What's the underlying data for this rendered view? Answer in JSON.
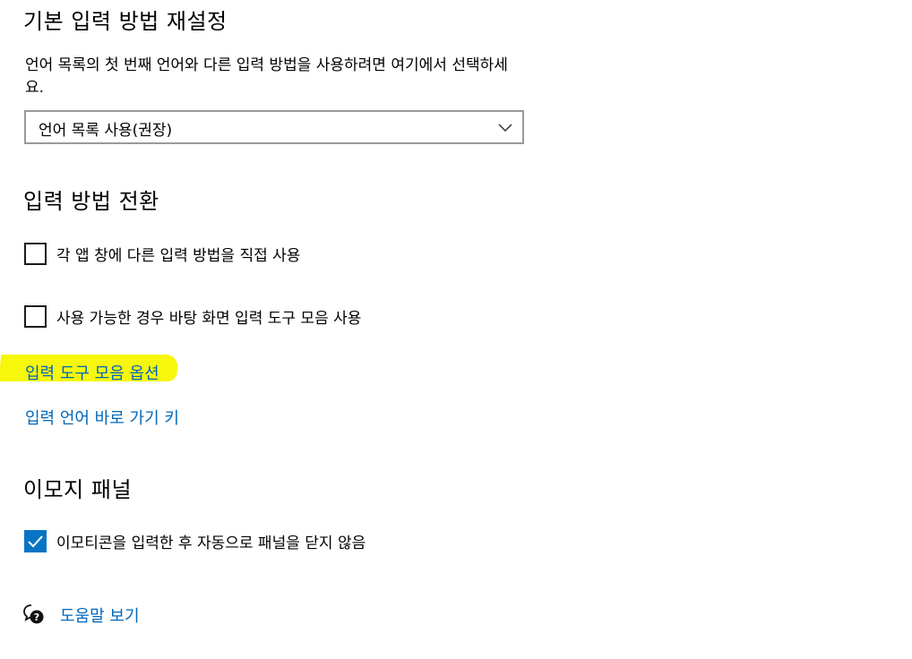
{
  "default_input": {
    "title": "기본 입력 방법 재설정",
    "description": "언어 목록의 첫 번째 언어와 다른 입력 방법을 사용하려면 여기에서 선택하세요.",
    "dropdown_value": "언어 목록 사용(권장)"
  },
  "switching": {
    "title": "입력 방법 전환",
    "option1": {
      "label": "각 앱 창에 다른 입력 방법을 직접 사용",
      "checked": false
    },
    "option2": {
      "label": "사용 가능한 경우 바탕 화면 입력 도구 모음 사용",
      "checked": false
    },
    "link_toolbar_options": "입력 도구 모음 옵션",
    "link_hotkeys": "입력 언어 바로 가기 키"
  },
  "emoji": {
    "title": "이모지 패널",
    "option": {
      "label": "이모티콘을 입력한 후 자동으로 패널을 닫지 않음",
      "checked": true
    }
  },
  "help": {
    "link": "도움말 보기",
    "icon": "help-chat-icon"
  },
  "colors": {
    "accent": "#0a74c4",
    "link": "#0067b8",
    "highlight": "#f6f70a"
  }
}
